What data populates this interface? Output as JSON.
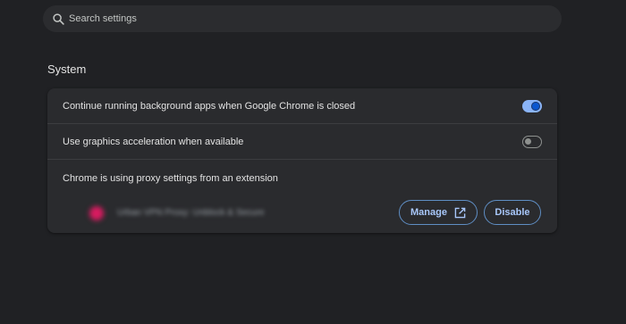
{
  "search": {
    "placeholder": "Search settings",
    "icon": "search-icon"
  },
  "section": {
    "title": "System"
  },
  "settings": {
    "background_apps": {
      "label": "Continue running background apps when Google Chrome is closed",
      "enabled": true
    },
    "graphics_acceleration": {
      "label": "Use graphics acceleration when available",
      "enabled": false
    },
    "proxy": {
      "label": "Chrome is using proxy settings from an extension",
      "extension_name": "Urban VPN Proxy: Unblock & Secure",
      "manage_label": "Manage",
      "manage_icon": "open-in-new-icon",
      "disable_label": "Disable"
    }
  },
  "colors": {
    "background": "#202124",
    "card": "#2a2b2e",
    "accent": "#a8c7fa",
    "toggle_on": "#8ab4f8",
    "extension_icon": "#d81b60"
  }
}
